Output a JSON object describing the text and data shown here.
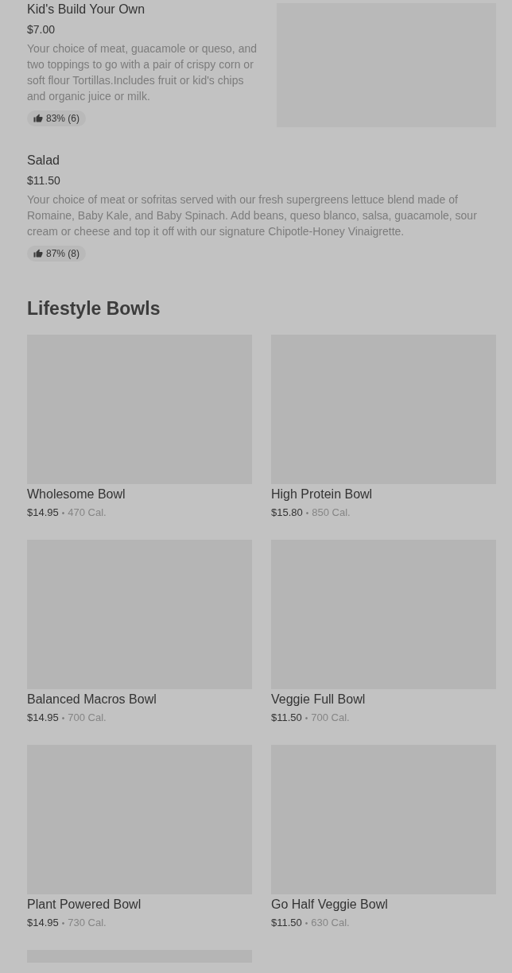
{
  "menu_items": [
    {
      "name": "Kid's Build Your Own",
      "price": "$7.00",
      "description": "Your choice of meat, guacamole or queso, and two toppings to go with a pair of crispy corn or soft flour Tortillas.Includes fruit or kid's chips and organic juice or milk.",
      "rating": "83% (6)",
      "has_image": true
    },
    {
      "name": "Salad",
      "price": "$11.50",
      "description": "Your choice of meat or sofritas served with our fresh supergreens lettuce blend made of Romaine, Baby Kale, and Baby Spinach. Add beans, queso blanco, salsa, guacamole, sour cream or cheese and top it off with our signature Chipotle-Honey Vinaigrette.",
      "rating": "87% (8)",
      "has_image": false
    }
  ],
  "section": {
    "title": "Lifestyle Bowls",
    "items": [
      {
        "name": "Wholesome Bowl",
        "price": "$14.95",
        "separator": "•",
        "calories": "470 Cal."
      },
      {
        "name": "High Protein Bowl",
        "price": "$15.80",
        "separator": "•",
        "calories": "850 Cal."
      },
      {
        "name": "Balanced Macros Bowl",
        "price": "$14.95",
        "separator": "•",
        "calories": "700 Cal."
      },
      {
        "name": "Veggie Full Bowl",
        "price": "$11.50",
        "separator": "•",
        "calories": "700 Cal."
      },
      {
        "name": "Plant Powered Bowl",
        "price": "$14.95",
        "separator": "•",
        "calories": "730 Cal."
      },
      {
        "name": "Go Half Veggie Bowl",
        "price": "$11.50",
        "separator": "•",
        "calories": "630 Cal."
      },
      {
        "kind": "picture"
      }
    ]
  }
}
